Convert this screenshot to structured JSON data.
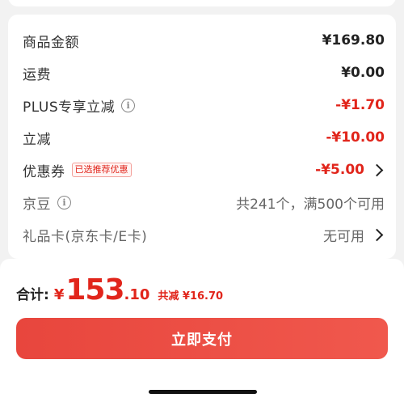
{
  "summary": {
    "rows": [
      {
        "label": "商品金额",
        "value": "¥169.80"
      },
      {
        "label": "运费",
        "value": "¥0.00"
      },
      {
        "label": "PLUS专享立减",
        "value": "-¥1.70",
        "icon": "info-icon"
      },
      {
        "label": "立减",
        "value": "-¥10.00"
      },
      {
        "label": "优惠券",
        "tag": "已选推荐优惠",
        "value": "-¥5.00",
        "icon": "chevron-right-icon"
      },
      {
        "label": "京豆",
        "value": "共241个，满500个可用",
        "icon": "info-icon"
      },
      {
        "label": "礼品卡(京东卡/E卡)",
        "value": "无可用",
        "icon": "chevron-right-icon"
      }
    ]
  },
  "footer": {
    "total_label": "合计:",
    "currency": "¥",
    "total_int": "153",
    "total_dec": ".10",
    "saved_text": "共减 ¥16.70",
    "pay_label": "立即支付"
  },
  "colors": {
    "accent": "#e1251b",
    "button": "#ec4f45",
    "background": "#f2f2f2"
  }
}
